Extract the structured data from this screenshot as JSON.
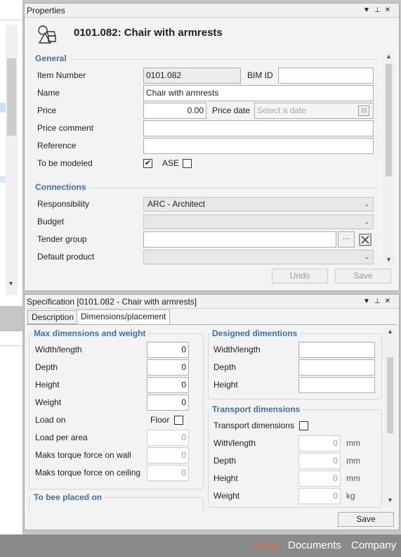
{
  "properties_panel": {
    "title": "Properties",
    "item_heading": "0101.082: Chair with armrests",
    "general": {
      "heading": "General",
      "item_number_label": "Item Number",
      "item_number_value": "0101.082",
      "bim_id_label": "BIM ID",
      "bim_id_value": "",
      "name_label": "Name",
      "name_value": "Chair with armrests",
      "price_label": "Price",
      "price_value": "0.00",
      "price_date_label": "Price date",
      "price_date_placeholder": "Select a date",
      "price_comment_label": "Price comment",
      "reference_label": "Reference",
      "to_be_modeled_label": "To be modeled",
      "to_be_modeled_checked": "✔",
      "ase_label": "ASE"
    },
    "connections": {
      "heading": "Connections",
      "responsibility_label": "Responsibility",
      "responsibility_value": "ARC - Architect",
      "budget_label": "Budget",
      "tender_group_label": "Tender group",
      "default_product_label": "Default product"
    },
    "undo_label": "Undo",
    "save_label": "Save"
  },
  "spec_panel": {
    "title": "Specification [0101.082 - Chair with armrests]",
    "tabs": [
      "Description",
      "Dimensions/placement"
    ],
    "max_dims": {
      "heading": "Max dimensions and weight",
      "width_label": "Width/length",
      "width_value": "0",
      "depth_label": "Depth",
      "depth_value": "0",
      "height_label": "Height",
      "height_value": "0",
      "weight_label": "Weight",
      "weight_value": "0",
      "load_on_label": "Load on",
      "floor_label": "Floor",
      "load_per_area_label": "Load per area",
      "load_per_area_value": "0",
      "torque_wall_label": "Maks torque force on wall",
      "torque_wall_value": "0",
      "torque_ceiling_label": "Maks torque force on ceiling",
      "torque_ceiling_value": "0"
    },
    "placed_on_heading": "To bee placed on",
    "designed": {
      "heading": "Designed dimentions",
      "width_label": "Width/length",
      "depth_label": "Depth",
      "height_label": "Height"
    },
    "transport": {
      "heading": "Transport dimensions",
      "toggle_label": "Transport dimensions",
      "width_label": "With/length",
      "width_value": "0",
      "width_unit": "mm",
      "depth_label": "Depth",
      "depth_value": "0",
      "depth_unit": "mm",
      "height_label": "Height",
      "height_value": "0",
      "height_unit": "mm",
      "weight_label": "Weight",
      "weight_value": "0",
      "weight_unit": "kg"
    },
    "save_label": "Save"
  },
  "footer": {
    "items": "Items",
    "documents": "Documents",
    "company": "Company",
    "active_color": "#e8622c"
  }
}
